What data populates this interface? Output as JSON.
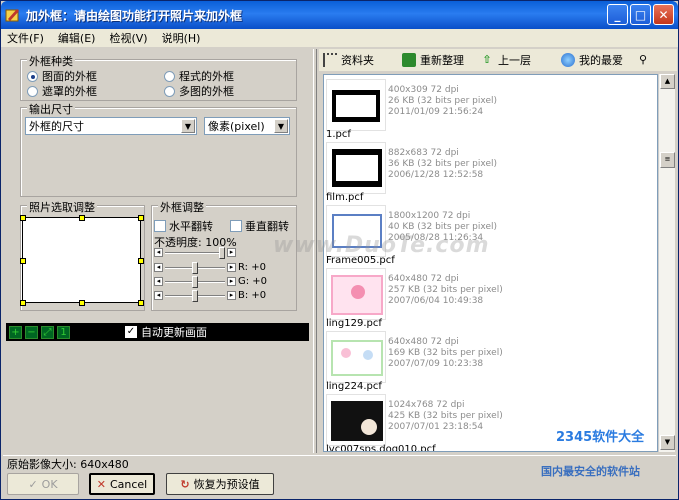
{
  "window": {
    "title": "加外框：请由绘图功能打开照片来加外框",
    "min": "_",
    "max": "□",
    "close": "✕"
  },
  "menu": [
    "文件(F)",
    "编辑(E)",
    "检视(V)",
    "说明(H)"
  ],
  "frame_type": {
    "label": "外框种类",
    "options": [
      {
        "label": "图面的外框",
        "checked": true
      },
      {
        "label": "程式的外框",
        "checked": false
      },
      {
        "label": "遮罩的外框",
        "checked": false
      },
      {
        "label": "多图的外框",
        "checked": false
      }
    ]
  },
  "output_size": {
    "label": "输出尺寸",
    "size_value": "外框的尺寸",
    "unit_value": "像素(pixel)"
  },
  "photo_adjust": {
    "label": "照片选取调整"
  },
  "frame_adjust": {
    "label": "外框调整",
    "flip_h": "水平翻转",
    "flip_v": "垂直翻转",
    "opacity": "不透明度: 100%",
    "r": "R: +0",
    "g": "G: +0",
    "b": "B: +0"
  },
  "preview": {
    "auto_update": "自动更新画面",
    "auto_checked": "✓"
  },
  "browser_toolbar": {
    "folder": "资料夹",
    "refresh": "重新整理",
    "up": "上一层",
    "favorites": "我的最爱"
  },
  "files": [
    {
      "name": "1.pcf",
      "dims": "400x309 72 dpi",
      "size": "26 KB (32 bits per pixel)",
      "date": "2011/01/09 21:56:24"
    },
    {
      "name": "film.pcf",
      "dims": "882x683 72 dpi",
      "size": "36 KB (32 bits per pixel)",
      "date": "2006/12/28 12:52:58"
    },
    {
      "name": "Frame005.pcf",
      "dims": "1800x1200 72 dpi",
      "size": "40 KB (32 bits per pixel)",
      "date": "2005/08/28 11:26:34"
    },
    {
      "name": "ling129.pcf",
      "dims": "640x480 72 dpi",
      "size": "257 KB (32 bits per pixel)",
      "date": "2007/06/04 10:49:38"
    },
    {
      "name": "ling224.pcf",
      "dims": "640x480 72 dpi",
      "size": "169 KB (32 bits per pixel)",
      "date": "2007/07/09 10:23:38"
    },
    {
      "name": "lvc007sps.dog010.pcf",
      "dims": "1024x768 72 dpi",
      "size": "425 KB (32 bits per pixel)",
      "date": "2007/07/01 23:18:54"
    }
  ],
  "status": {
    "original_size": "原始影像大小:  640x480"
  },
  "buttons": {
    "ok": "OK",
    "cancel": "Cancel",
    "reset": "恢复为预设值"
  },
  "watermarks": {
    "center": "www.DuoTe.com",
    "logo": "2345软件大全",
    "site": "国内最安全的软件站"
  }
}
